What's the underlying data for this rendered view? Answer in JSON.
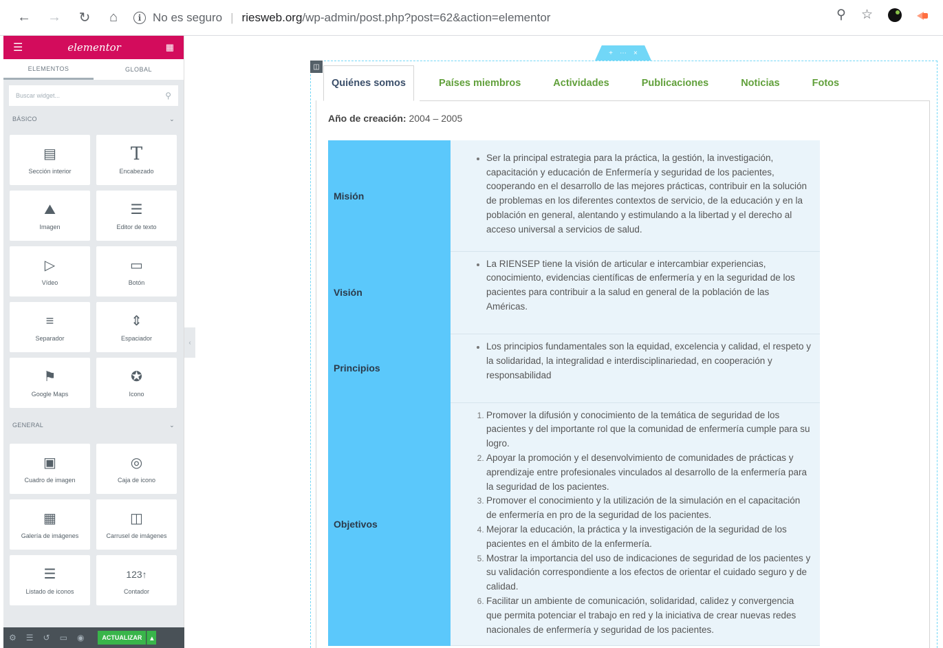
{
  "browser": {
    "security_text": "No es seguro",
    "url_host": "riesweb.org",
    "url_path": "/wp-admin/post.php?post=62&action=elementor"
  },
  "panel": {
    "logo": "elementor",
    "tabs": [
      "ELEMENTOS",
      "GLOBAL"
    ],
    "search_placeholder": "Buscar widget...",
    "categories": {
      "basic": "BÁSICO",
      "general": "GENERAL"
    },
    "basic_widgets": [
      {
        "label": "Sección interior",
        "icon": "columns-icon"
      },
      {
        "label": "Encabezado",
        "icon": "heading-icon"
      },
      {
        "label": "Imagen",
        "icon": "image-icon"
      },
      {
        "label": "Editor de texto",
        "icon": "text-editor-icon"
      },
      {
        "label": "Vídeo",
        "icon": "video-icon"
      },
      {
        "label": "Botón",
        "icon": "button-icon"
      },
      {
        "label": "Separador",
        "icon": "divider-icon"
      },
      {
        "label": "Espaciador",
        "icon": "spacer-icon"
      },
      {
        "label": "Google Maps",
        "icon": "map-icon"
      },
      {
        "label": "Icono",
        "icon": "star-icon"
      }
    ],
    "general_widgets": [
      {
        "label": "Cuadro de imagen",
        "icon": "image-box-icon"
      },
      {
        "label": "Caja de icono",
        "icon": "icon-box-icon"
      },
      {
        "label": "Galería de imágenes",
        "icon": "gallery-icon"
      },
      {
        "label": "Carrusel de imágenes",
        "icon": "carousel-icon"
      },
      {
        "label": "Listado de iconos",
        "icon": "icon-list-icon"
      },
      {
        "label": "Contador",
        "icon": "counter-icon"
      }
    ],
    "footer": {
      "update_label": "ACTUALIZAR"
    }
  },
  "content": {
    "tabs": [
      "Quiénes somos",
      "Países miembros",
      "Actividades",
      "Publicaciones",
      "Noticias",
      "Fotos"
    ],
    "active_tab": "Quiénes somos",
    "year_label": "Año de creación:",
    "year_value": " 2004 – 2005",
    "rows": [
      {
        "label": "Misión",
        "type": "ul",
        "items": [
          "Ser la principal estrategia para la práctica, la gestión, la investigación, capacitación y educación de Enfermería y seguridad de los pacientes, cooperando en el desarrollo de las mejores prácticas, contribuir en la solución de problemas en los diferentes contextos de servicio, de la educación y en la población en general, alentando y estimulando a la libertad y el derecho al acceso universal a servicios de salud."
        ]
      },
      {
        "label": "Visión",
        "type": "ul",
        "items": [
          "La RIENSEP tiene la visión de articular e intercambiar experiencias, conocimiento, evidencias científicas de enfermería y en la seguridad de los pacientes para contribuir a la salud en general de la población de las Américas."
        ]
      },
      {
        "label": "Principios",
        "type": "ul",
        "items": [
          "Los principios fundamentales son la equidad, excelencia y calidad, el respeto y la solidaridad, la integralidad e interdisciplinariedad, en cooperación y  responsabilidad"
        ]
      },
      {
        "label": "Objetivos",
        "type": "ol",
        "items": [
          "Promover la difusión y conocimiento de la temática de seguridad de los pacientes y del importante rol que la comunidad de enfermería cumple para su logro.",
          "Apoyar la promoción y el desenvolvimiento de comunidades de prácticas y aprendizaje entre profesionales vinculados al desarrollo de la enfermería para la seguridad de los pacientes.",
          "Promover el conocimiento y la utilización de la simulación en el capacitación de enfermería en pro de la seguridad de los pacientes.",
          "Mejorar la educación, la práctica y la investigación de la seguridad de los pacientes en el ámbito de la enfermería.",
          "Mostrar la importancia del uso de indicaciones de seguridad de los pacientes y su validación correspondiente a los efectos de orientar el cuidado seguro y de calidad.",
          "Facilitar un ambiente de comunicación, solidaridad, calidez y convergencia que permita potenciar el trabajo en red y la iniciativa de crear nuevas redes nacionales de enfermería y seguridad de los pacientes."
        ]
      }
    ]
  },
  "colors": {
    "elementor_brand": "#d30c5c",
    "tab_link": "#61a03b",
    "row_label_bg": "#5bc8fb",
    "update_button": "#39b54a"
  }
}
